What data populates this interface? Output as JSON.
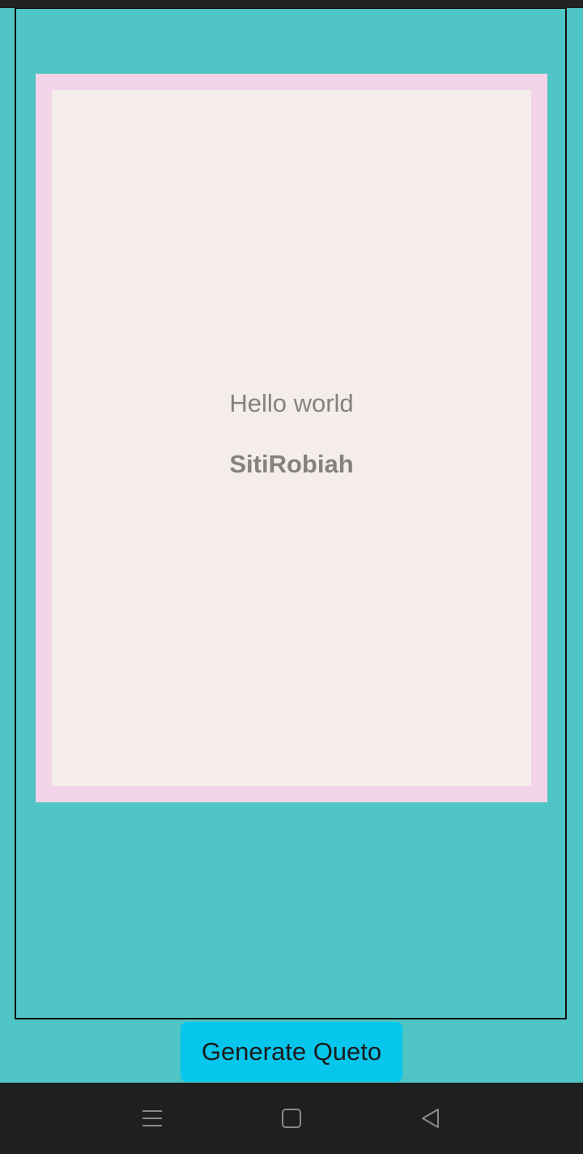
{
  "card": {
    "quote": "Hello world",
    "author": "SitiRobiah"
  },
  "actions": {
    "generate_label": "Generate Queto"
  },
  "navigation": {
    "icons": [
      "menu-icon",
      "home-icon",
      "back-icon"
    ]
  },
  "colors": {
    "background": "#4fc5c5",
    "card_border": "#f3d3ea",
    "card_fill": "#f5edea",
    "text": "#848280",
    "button": "#06c6ec",
    "nav_bar": "#1f1f1f"
  }
}
